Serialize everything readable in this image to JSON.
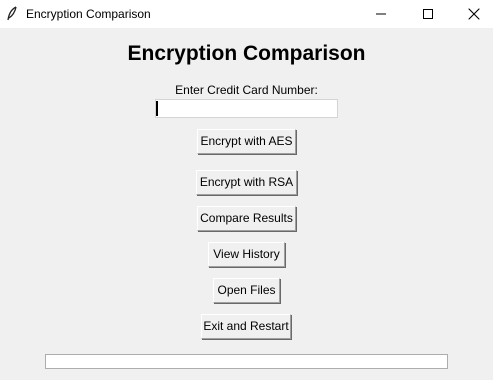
{
  "window": {
    "title": "Encryption Comparison",
    "icon": "feather-icon"
  },
  "main": {
    "heading": "Encryption Comparison",
    "card_label": "Enter Credit Card Number:",
    "card_value": ""
  },
  "buttons": {
    "aes": "Encrypt with AES",
    "rsa": "Encrypt with RSA",
    "compare": "Compare Results",
    "history": "View History",
    "open_files": "Open Files",
    "exit": "Exit and Restart"
  },
  "output": {
    "value": ""
  }
}
